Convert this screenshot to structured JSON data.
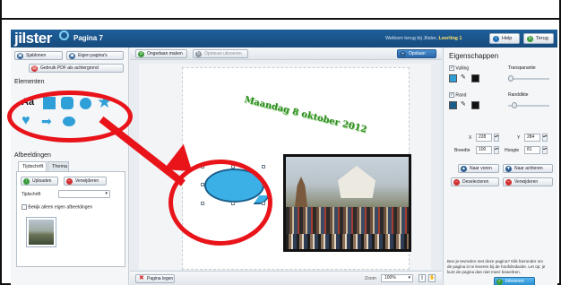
{
  "app": {
    "logo": "jilster",
    "page_title": "Pagina 7",
    "welcome_prefix": "Welkom terug bij Jilster,",
    "user": "Leerling 1",
    "help_label": "Help",
    "back_label": "Terug"
  },
  "left_panel": {
    "btn_sjablonen": "Sjablonen",
    "btn_eigen": "Eigen pagina's",
    "btn_pdf": "Gebruik PDF als achtergrond",
    "elements_title": "Elementen",
    "element_text": "Aa",
    "afbeeldingen_title": "Afbeeldingen",
    "tab_tijdschrift": "Tijdschrift",
    "tab_thema": "Thema",
    "btn_upload": "Uploaden",
    "btn_remove": "Verwijderen",
    "select_label": "Tijdschrift",
    "checkbox_label": "Bekijk alleen eigen afbeeldingen"
  },
  "canvas": {
    "btn_ongedaan": "Ongedaan maken",
    "btn_opnieuw": "Opnieuw uitvoeren",
    "btn_opslaan": "Opslaan",
    "heading_text": "Maandag 8 oktober 2012",
    "btn_pagina_legen": "Pagina legen",
    "zoom_label": "Zoom",
    "zoom_value": "100%"
  },
  "right_panel": {
    "title": "Eigenschappen",
    "vulling_label": "Vulling",
    "transparantie_label": "Transparantie",
    "rand_label": "Rand",
    "randdikte_label": "Randdikte",
    "x_label": "X",
    "x_value": "228",
    "y_label": "Y",
    "y_value": "284",
    "breedte_label": "Breedte",
    "breedte_value": "100",
    "hoogte_label": "Hoogte",
    "hoogte_value": "81",
    "btn_voren": "Naar voren",
    "btn_achteren": "Naar achteren",
    "btn_deselecteren": "Deselecteren",
    "btn_verwijderen": "Verwijderen",
    "info_text": "Ben je tevreden met deze pagina? Klik hieronder om de pagina in te leveren bij de hoofdredactie. Let op: je kunt de pagina dan niet meer bewerken.",
    "btn_inleveren": "Inleveren"
  },
  "colors": {
    "header_blue": "#1f5f9a",
    "shape_blue": "#2f9fd8",
    "annotation_red": "#e8141a",
    "date_green": "#2b8c1d"
  }
}
